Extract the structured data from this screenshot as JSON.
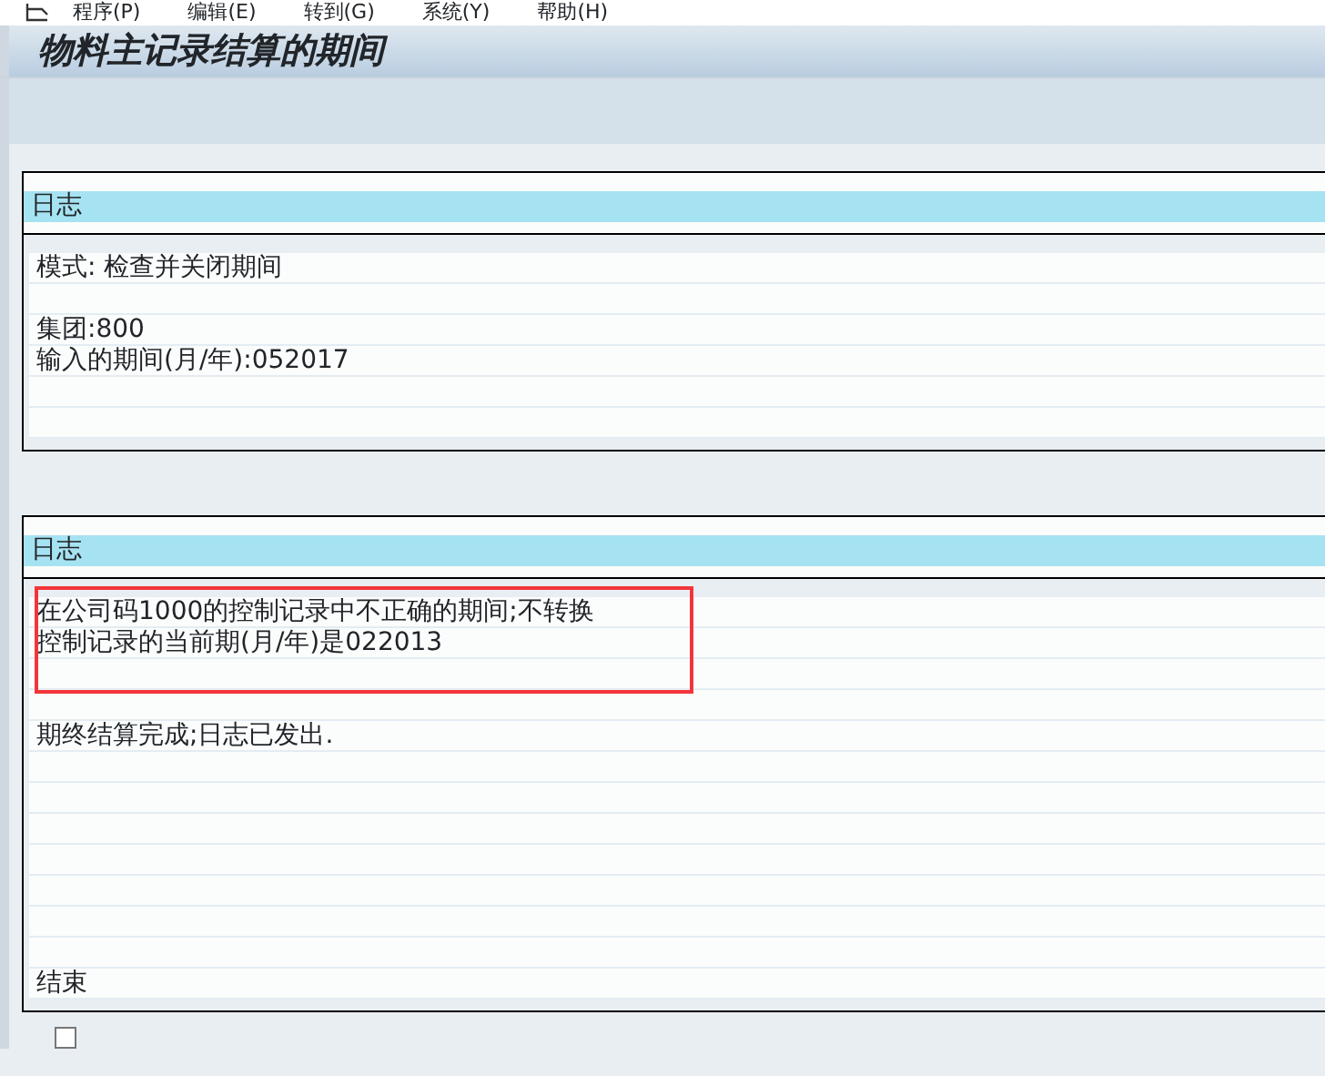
{
  "menu": [
    "程序(P)",
    "编辑(E)",
    "转到(G)",
    "系统(Y)",
    "帮助(H)"
  ],
  "title": "物料主记录结算的期间",
  "logs": [
    {
      "header": "日志",
      "lines": [
        {
          "kind": "text",
          "text": "模式: 检查并关闭期间"
        },
        {
          "kind": "blank"
        },
        {
          "kind": "text",
          "text": "集团:800"
        },
        {
          "kind": "text",
          "text": "输入的期间(月/年):052017"
        },
        {
          "kind": "blank"
        },
        {
          "kind": "blank"
        }
      ]
    },
    {
      "header": "日志",
      "lines": [
        {
          "kind": "text",
          "text": "在公司码1000的控制记录中不正确的期间;不转换",
          "highlighted": true
        },
        {
          "kind": "text",
          "text": "控制记录的当前期(月/年)是022013",
          "highlighted": true
        },
        {
          "kind": "blank",
          "highlighted": true
        },
        {
          "kind": "blank"
        },
        {
          "kind": "text",
          "text": "期终结算完成;日志已发出."
        },
        {
          "kind": "blank"
        },
        {
          "kind": "blank"
        },
        {
          "kind": "blank"
        },
        {
          "kind": "blank"
        },
        {
          "kind": "blank"
        },
        {
          "kind": "blank"
        },
        {
          "kind": "blank"
        },
        {
          "kind": "text",
          "text": "结束"
        }
      ]
    }
  ],
  "checkbox": {
    "checked": false
  }
}
